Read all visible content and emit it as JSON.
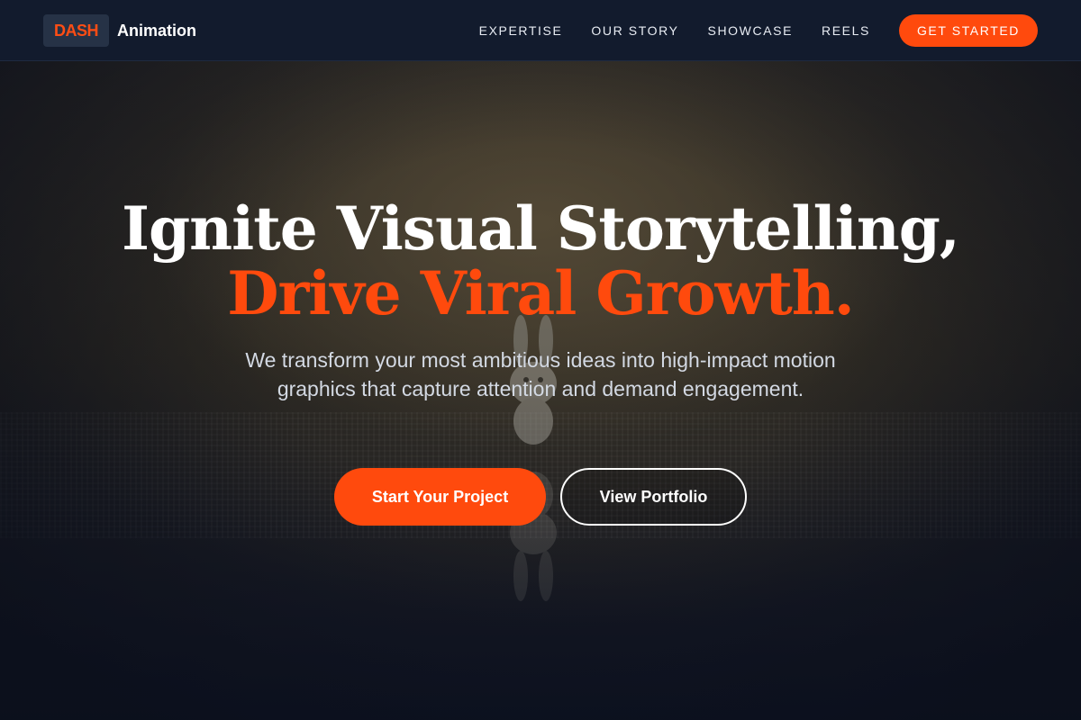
{
  "brand": {
    "badge": "DASH",
    "name": "Animation"
  },
  "nav": {
    "items": [
      {
        "label": "EXPERTISE"
      },
      {
        "label": "OUR STORY"
      },
      {
        "label": "SHOWCASE"
      },
      {
        "label": "REELS"
      }
    ],
    "cta_label": "GET STARTED"
  },
  "hero": {
    "title_line1": "Ignite Visual Storytelling,",
    "title_line2": "Drive Viral Growth.",
    "subtitle": "We transform your most ambitious ideas into high-impact motion graphics that capture attention and demand engagement.",
    "primary_button": "Start Your Project",
    "secondary_button": "View Portfolio"
  },
  "colors": {
    "accent": "#ff4a0d",
    "header_bg": "#121b2d",
    "page_bg": "#0e1526",
    "text_primary": "#ffffff",
    "text_muted": "#d3d9e3"
  }
}
